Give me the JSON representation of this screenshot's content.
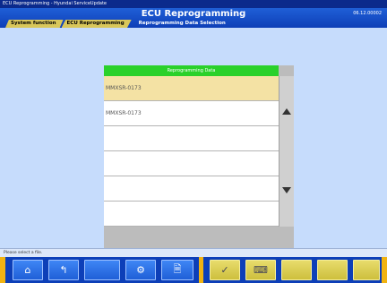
{
  "window": {
    "title": "ECU Reprogramming - Hyundai ServiceUpdate"
  },
  "header": {
    "title": "ECU Reprogramming",
    "code": "06.12.00002"
  },
  "breadcrumb": [
    {
      "label": "System function"
    },
    {
      "label": "ECU Reprogramming"
    },
    {
      "label": "Reprogramming Data Selection"
    }
  ],
  "list": {
    "header": "Reprogramming Data",
    "items": [
      {
        "label": "MMXSR-0173",
        "selected": true
      },
      {
        "label": "MMXSR-0173",
        "selected": false
      },
      {
        "label": "",
        "selected": false
      },
      {
        "label": "",
        "selected": false
      },
      {
        "label": "",
        "selected": false
      },
      {
        "label": "",
        "selected": false
      }
    ]
  },
  "status": {
    "text": "Please select a file."
  },
  "toolbar": {
    "buttons": [
      {
        "name": "home-button",
        "icon": "house-icon",
        "glyph": "⌂"
      },
      {
        "name": "back-button",
        "icon": "back-icon",
        "glyph": "↰"
      },
      {
        "name": "blank-button-1",
        "icon": "",
        "glyph": ""
      },
      {
        "name": "tools-button",
        "icon": "tools-icon",
        "glyph": "⚙"
      },
      {
        "name": "print-button",
        "icon": "print-icon",
        "glyph": "🗎"
      },
      {
        "name": "confirm-button",
        "icon": "check-icon",
        "glyph": "✓"
      },
      {
        "name": "keyboard-button",
        "icon": "keyboard-icon",
        "glyph": "⌨"
      },
      {
        "name": "blank-button-2",
        "icon": "",
        "glyph": ""
      },
      {
        "name": "blank-button-3",
        "icon": "",
        "glyph": ""
      },
      {
        "name": "blank-button-4",
        "icon": "",
        "glyph": ""
      }
    ]
  }
}
